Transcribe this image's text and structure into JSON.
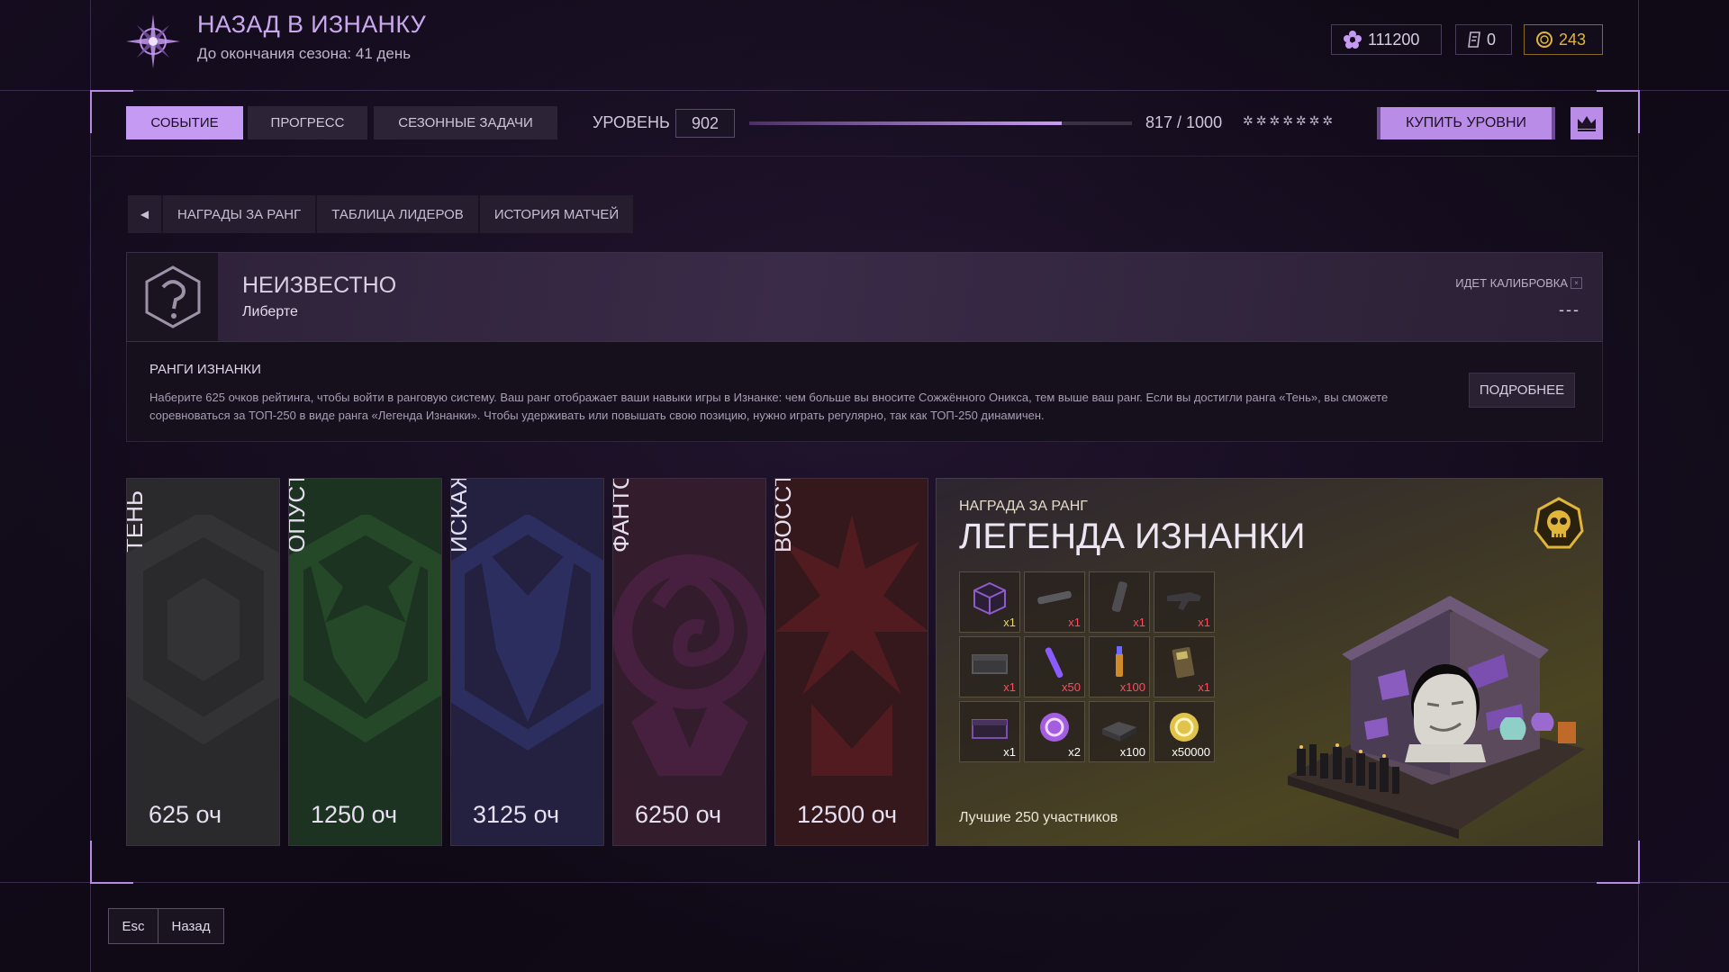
{
  "header": {
    "title": "НАЗАД В ИЗНАНКУ",
    "subtitle": "До окончания сезона: 41 день",
    "currencies": [
      {
        "icon": "flower-currency-icon",
        "value": "111200"
      },
      {
        "icon": "ticket-icon",
        "value": "0"
      },
      {
        "icon": "gold-coin-icon",
        "value": "243"
      }
    ]
  },
  "nav": {
    "tabs": [
      {
        "label": "СОБЫТИЕ",
        "active": true
      },
      {
        "label": "ПРОГРЕСС",
        "active": false
      },
      {
        "label": "СЕЗОННЫЕ ЗАДАЧИ",
        "active": false
      }
    ],
    "level_label": "УРОВЕНЬ",
    "level_value": "902",
    "progress": {
      "current": 817,
      "max": 1000,
      "text": "817 / 1000",
      "fraction": 0.817
    },
    "stars": "✲✲✲✲✲✲✲",
    "buy_label": "КУПИТЬ УРОВНИ"
  },
  "subtabs": [
    {
      "label": "НАГРАДЫ ЗА РАНГ"
    },
    {
      "label": "ТАБЛИЦА ЛИДЕРОВ"
    },
    {
      "label": "ИСТОРИЯ МАТЧЕЙ"
    }
  ],
  "rank_status": {
    "title": "НЕИЗВЕСТНО",
    "player": "Либерте",
    "calibration": "ИДЕТ КАЛИБРОВКА",
    "placement": "---"
  },
  "info": {
    "title": "РАНГИ ИЗНАНКИ",
    "text": "Наберите 625 очков рейтинга, чтобы войти в ранговую систему. Ваш ранг отображает ваши навыки игры в Изнанке: чем больше вы вносите Сожжённого Оникса, тем выше ваш ранг. Если вы достигли ранга «Тень», вы сможете соревноваться за ТОП-250 в виде ранга «Легенда Изнанки». Чтобы удерживать или повышать свою позицию, нужно играть регулярно, так как ТОП-250 динамичен.",
    "more_label": "ПОДРОБНЕЕ"
  },
  "ranks": [
    {
      "name": "ТЕНЬ",
      "points": "625 оч",
      "color": "#2a2a2c",
      "accent": "#3b3b3e"
    },
    {
      "name": "ОПУСТОШЕННЫЙ",
      "points": "1250 оч",
      "color": "#1d3321",
      "accent": "#2b5a2e"
    },
    {
      "name": "ИСКАЖЕННЫЙ",
      "points": "3125 оч",
      "color": "#232040",
      "accent": "#343a7a"
    },
    {
      "name": "ФАНТОМ",
      "points": "6250 оч",
      "color": "#331c2c",
      "accent": "#5a2550"
    },
    {
      "name": "ВОССТАВШИЙ",
      "points": "12500 оч",
      "color": "#34181c",
      "accent": "#6a1e24"
    }
  ],
  "reward": {
    "small_title": "НАГРАДА ЗА РАНГ",
    "title": "ЛЕГЕНДА ИЗНАНКИ",
    "footer": "Лучшие 250 участников",
    "items": [
      {
        "icon": "purple-cube-icon",
        "qty": "x1",
        "qty_color": "#e8d86a"
      },
      {
        "icon": "pipe-icon",
        "qty": "x1",
        "qty_color": "#ff4d5e"
      },
      {
        "icon": "tube-icon",
        "qty": "x1",
        "qty_color": "#ff4d5e"
      },
      {
        "icon": "weapon-icon",
        "qty": "x1",
        "qty_color": "#ff4d5e"
      },
      {
        "icon": "crate-icon",
        "qty": "x1",
        "qty_color": "#ff4d5e"
      },
      {
        "icon": "glowstick-icon",
        "qty": "x50",
        "qty_color": "#ff4d5e"
      },
      {
        "icon": "flare-icon",
        "qty": "x100",
        "qty_color": "#ff4d5e"
      },
      {
        "icon": "device-icon",
        "qty": "x1",
        "qty_color": "#ff4d5e"
      },
      {
        "icon": "purple-case-icon",
        "qty": "x1",
        "qty_color": "#ffffff"
      },
      {
        "icon": "purple-token-icon",
        "qty": "x2",
        "qty_color": "#ffffff"
      },
      {
        "icon": "ammo-box-icon",
        "qty": "x100",
        "qty_color": "#ffffff"
      },
      {
        "icon": "gold-token-icon",
        "qty": "x50000",
        "qty_color": "#ffffff"
      }
    ]
  },
  "footer": {
    "key": "Esc",
    "label": "Назад"
  },
  "colors": {
    "accent": "#c59af2",
    "background": "#110b18",
    "gold": "#e0b53a"
  }
}
